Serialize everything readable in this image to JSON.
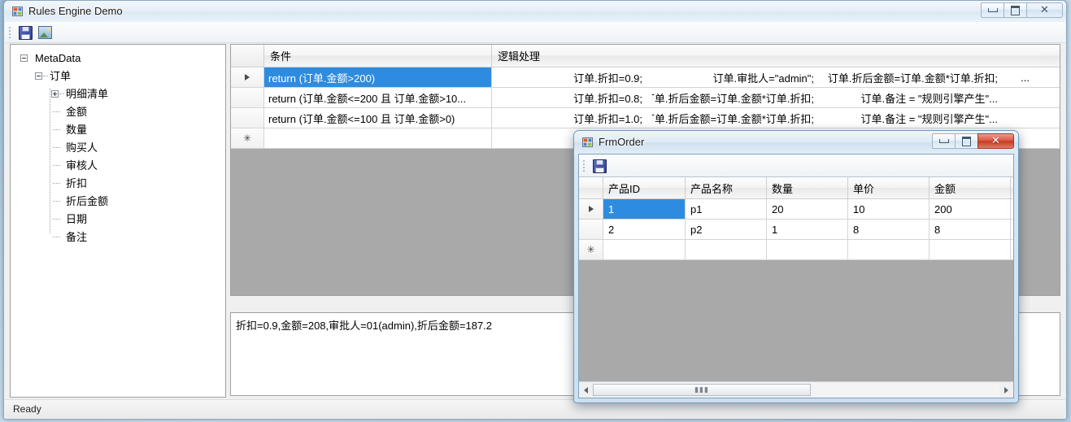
{
  "main_window": {
    "title": "Rules Engine Demo",
    "app_icon": "form-icon",
    "controls": {
      "minimize": "minimize-icon",
      "maximize": "maximize-icon",
      "close": "close-icon"
    },
    "toolbar": [
      {
        "name": "save-button",
        "icon": "floppy-disk-icon"
      },
      {
        "name": "image-button",
        "icon": "picture-icon"
      }
    ],
    "statusbar": {
      "text": "Ready"
    }
  },
  "tree": {
    "root_label": "MetaData",
    "items": [
      {
        "label": "MetaData",
        "depth": 0,
        "expander": "minus"
      },
      {
        "label": "订单",
        "depth": 1,
        "expander": "minus"
      },
      {
        "label": "明细清单",
        "depth": 2,
        "expander": "plus"
      },
      {
        "label": "金额",
        "depth": 2,
        "expander": "none"
      },
      {
        "label": "数量",
        "depth": 2,
        "expander": "none"
      },
      {
        "label": "购买人",
        "depth": 2,
        "expander": "none"
      },
      {
        "label": "审核人",
        "depth": 2,
        "expander": "none"
      },
      {
        "label": "折扣",
        "depth": 2,
        "expander": "none"
      },
      {
        "label": "折后金额",
        "depth": 2,
        "expander": "none"
      },
      {
        "label": "日期",
        "depth": 2,
        "expander": "none"
      },
      {
        "label": "备注",
        "depth": 2,
        "expander": "none"
      }
    ]
  },
  "rules_grid": {
    "columns": [
      {
        "label": "条件"
      },
      {
        "label": "逻辑处理"
      }
    ],
    "rows": [
      {
        "selector": "current-row-arrow",
        "selected": true,
        "condition": "return (订单.金额>200)",
        "logic": [
          "订单.折扣=0.9;",
          "订单.审批人=\"admin\";",
          "订单.折后金额=订单.金额*订单.折扣;",
          "..."
        ]
      },
      {
        "selector": "",
        "selected": false,
        "condition": "return (订单.金额<=200 且 订单.金额>10...",
        "logic": [
          "订单.折扣=0.8;",
          "订单.折后金额=订单.金额*订单.折扣;",
          "订单.备注 = \"规则引擎产生\"..."
        ]
      },
      {
        "selector": "",
        "selected": false,
        "condition": "return (订单.金额<=100 且 订单.金额>0)",
        "logic": [
          "订单.折扣=1.0;",
          "订单.折后金额=订单.金额*订单.折扣;",
          "订单.备注 = \"规则引擎产生\"..."
        ]
      },
      {
        "selector": "new-row-star",
        "selected": false,
        "condition": "",
        "logic": [
          "",
          "",
          ""
        ]
      }
    ]
  },
  "output": {
    "text": "折扣=0.9,金额=208,审批人=01(admin),折后金额=187.2"
  },
  "frm_order": {
    "title": "FrmOrder",
    "app_icon": "form-icon",
    "controls": {
      "minimize": "minimize-icon",
      "maximize": "maximize-icon",
      "close": "close-icon"
    },
    "toolbar": [
      {
        "name": "save-button",
        "icon": "floppy-disk-icon"
      }
    ],
    "grid": {
      "columns": [
        "产品ID",
        "产品名称",
        "数量",
        "单价",
        "金额"
      ],
      "rows": [
        {
          "selector": "current-row-arrow",
          "cells": [
            "1",
            "p1",
            "20",
            "10",
            "200"
          ],
          "selected_cell": 0
        },
        {
          "selector": "",
          "cells": [
            "2",
            "p2",
            "1",
            "8",
            "8"
          ],
          "selected_cell": -1
        },
        {
          "selector": "new-row-star",
          "cells": [
            "",
            "",
            "",
            "",
            ""
          ],
          "selected_cell": -1
        }
      ]
    },
    "hscrollbar": {
      "left_arrow": "scroll-left-icon",
      "right_arrow": "scroll-right-icon",
      "grip": "⦙⦙⦙"
    }
  },
  "colors": {
    "selection": "#2e8ce0",
    "grid_background": "#a9a9a9",
    "close_button_active": "#c63a24"
  }
}
